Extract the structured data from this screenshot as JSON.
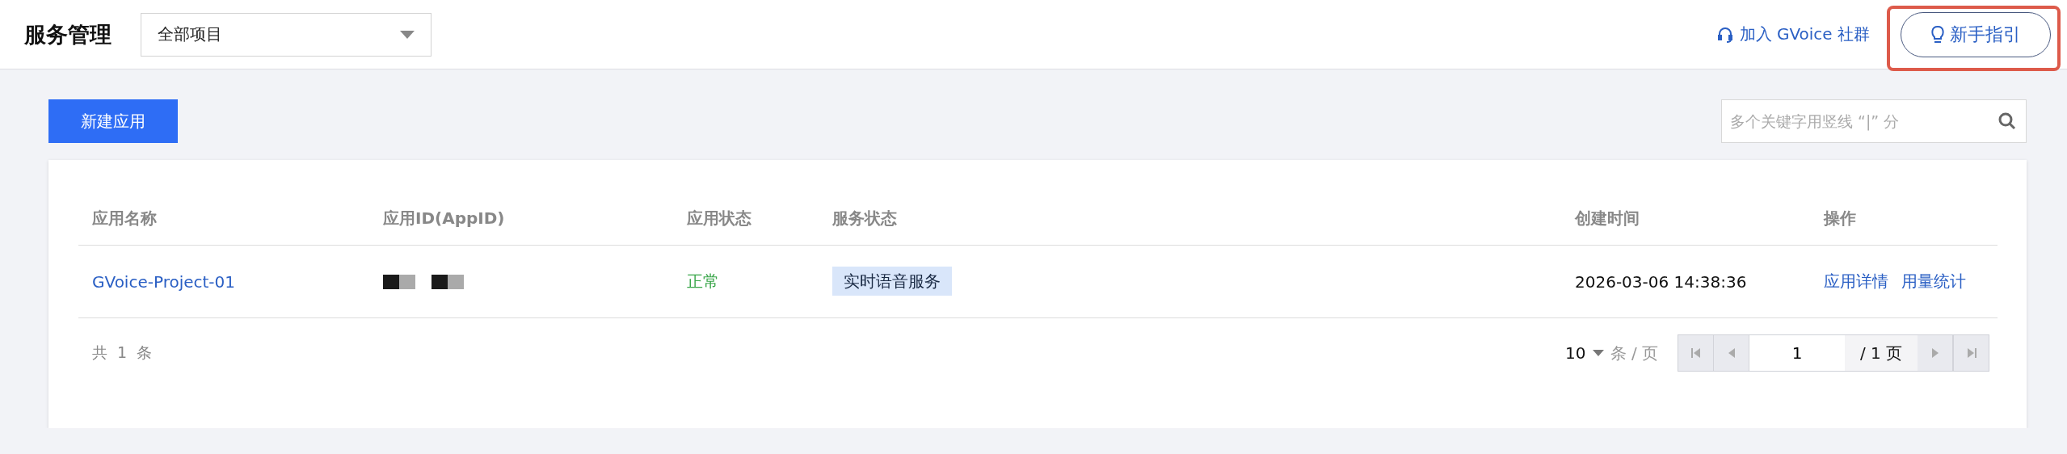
{
  "header": {
    "title": "服务管理",
    "project_select": {
      "value": "全部项目"
    },
    "community_link": "加入 GVoice 社群",
    "guide_button": {
      "label": "新手指引",
      "highlighted": true
    }
  },
  "toolbar": {
    "new_button": "新建应用",
    "search": {
      "placeholder": "多个关键字用竖线 “|” 分"
    }
  },
  "table": {
    "columns": [
      "应用名称",
      "应用ID(AppID)",
      "应用状态",
      "服务状态",
      "创建时间",
      "操作"
    ],
    "rows": [
      {
        "name": "GVoice-Project-01",
        "app_id_redacted": true,
        "status": {
          "label": "正常",
          "color": "#3aa64a"
        },
        "services": [
          "实时语音服务"
        ],
        "created": "2026-03-06 14:38:36",
        "actions": [
          "应用详情",
          "用量统计"
        ]
      }
    ]
  },
  "footer": {
    "total": "共 1 条",
    "page_size": "10",
    "page_size_unit": "条 / 页",
    "page": "1",
    "pages": "/ 1 页"
  }
}
